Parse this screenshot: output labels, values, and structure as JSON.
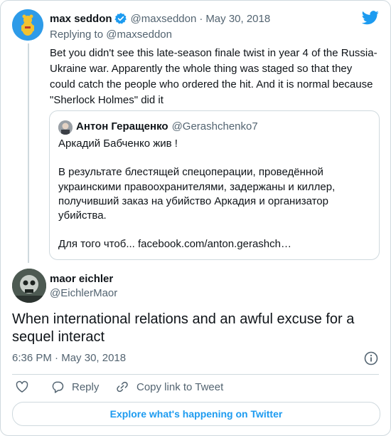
{
  "tweet1": {
    "author_name": "max seddon",
    "handle": "@maxseddon",
    "date": "May 30, 2018",
    "replying": "Replying to @maxseddon",
    "text_lines": [
      "Bet you didn't see this late-season finale twist in year 4 of the Russia-",
      "Ukraine war. Apparently the whole thing was staged so that they",
      "could catch the people who ordered the hit. And it is normal because",
      "\"Sherlock Holmes\" did it"
    ]
  },
  "quote": {
    "author_name": "Антон Геращенко",
    "handle": "@Gerashchenko7",
    "lines": [
      "Аркадий Бабченко жив !",
      "В результате блестящей  спецоперации,  проведённой",
      "украинскими правоохранителями, задержаны  и киллер,",
      "получивший заказ на убийство Аркадия и организатор",
      "убийства.",
      "Для того чтоб... facebook.com/anton.gerashch…"
    ]
  },
  "tweet2": {
    "author_name": "maor eichler",
    "handle": "@EichlerMaor",
    "text_lines": [
      "When international relations and an awful excuse for a",
      "sequel interact"
    ],
    "time": "6:36 PM",
    "date": "May 30, 2018"
  },
  "actions": {
    "reply_label": "Reply",
    "copy_label": "Copy link to Tweet"
  },
  "explore_label": "Explore what's happening on Twitter",
  "icons": {
    "brand": "twitter-bird-icon",
    "verified": "verified-badge-icon",
    "info": "info-icon",
    "like": "heart-icon",
    "reply": "reply-bubble-icon",
    "copy": "link-icon"
  },
  "colors": {
    "accent": "#1d9bf0",
    "muted": "#536471",
    "border": "#cfd9de"
  }
}
